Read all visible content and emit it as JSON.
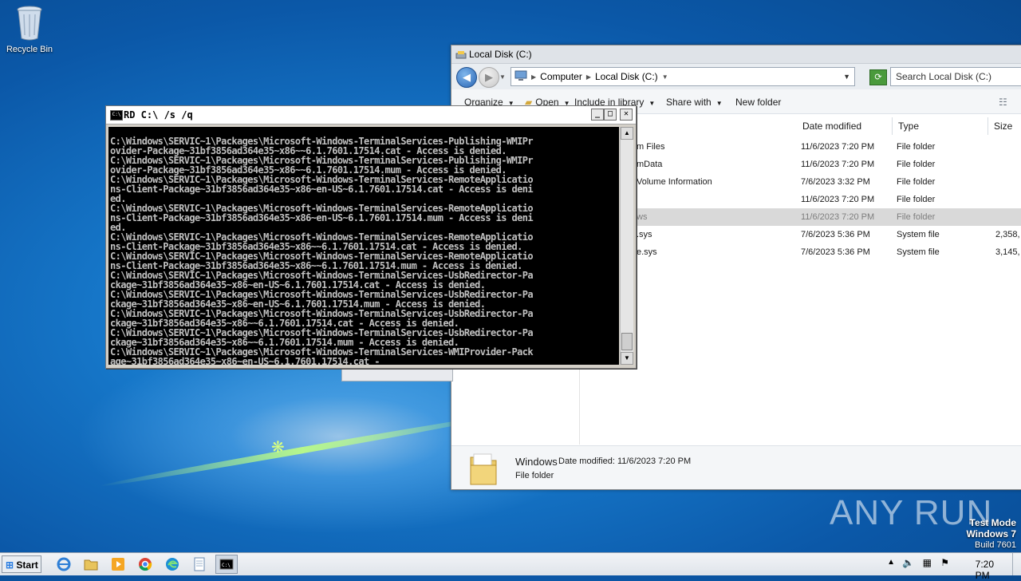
{
  "desktop": {
    "recycle_bin_label": "Recycle Bin",
    "watermark": "ANY RUN",
    "test_mode": {
      "line1": "Test Mode",
      "line2": "Windows 7",
      "line3": "Build 7601"
    }
  },
  "explorer": {
    "title": "Local Disk (C:)",
    "breadcrumb": [
      "Computer",
      "Local Disk (C:)"
    ],
    "search_placeholder": "Search Local Disk (C:)",
    "commands": {
      "organize": "Organize",
      "open": "Open",
      "include_in_library": "Include in library",
      "share_with": "Share with",
      "new_folder": "New folder"
    },
    "columns": {
      "date_modified": "Date modified",
      "type": "Type",
      "size": "Size"
    },
    "rows": [
      {
        "name": "m Files",
        "date": "11/6/2023 7:20 PM",
        "type": "File folder",
        "size": "",
        "selected": false
      },
      {
        "name": "mData",
        "date": "11/6/2023 7:20 PM",
        "type": "File folder",
        "size": "",
        "selected": false
      },
      {
        "name": "Volume Information",
        "date": "7/6/2023 3:32 PM",
        "type": "File folder",
        "size": "",
        "selected": false
      },
      {
        "name": "",
        "date": "11/6/2023 7:20 PM",
        "type": "File folder",
        "size": "",
        "selected": false
      },
      {
        "name": "ws",
        "date": "11/6/2023 7:20 PM",
        "type": "File folder",
        "size": "",
        "selected": true
      },
      {
        "name": ".sys",
        "date": "7/6/2023 5:36 PM",
        "type": "System file",
        "size": "2,358,",
        "selected": false
      },
      {
        "name": "e.sys",
        "date": "7/6/2023 5:36 PM",
        "type": "System file",
        "size": "3,145,",
        "selected": false
      }
    ],
    "details": {
      "name": "Windows",
      "modified": "Date modified: 11/6/2023 7:20 PM",
      "type": "File folder"
    }
  },
  "cmd": {
    "title": "RD C:\\ /s /q",
    "lines": [
      "",
      "C:\\Windows\\SERVIC~1\\Packages\\Microsoft-Windows-TerminalServices-Publishing-WMIPr",
      "ovider-Package~31bf3856ad364e35~x86~~6.1.7601.17514.cat - Access is denied.",
      "C:\\Windows\\SERVIC~1\\Packages\\Microsoft-Windows-TerminalServices-Publishing-WMIPr",
      "ovider-Package~31bf3856ad364e35~x86~~6.1.7601.17514.mum - Access is denied.",
      "C:\\Windows\\SERVIC~1\\Packages\\Microsoft-Windows-TerminalServices-RemoteApplicatio",
      "ns-Client-Package~31bf3856ad364e35~x86~en-US~6.1.7601.17514.cat - Access is deni",
      "ed.",
      "C:\\Windows\\SERVIC~1\\Packages\\Microsoft-Windows-TerminalServices-RemoteApplicatio",
      "ns-Client-Package~31bf3856ad364e35~x86~en-US~6.1.7601.17514.mum - Access is deni",
      "ed.",
      "C:\\Windows\\SERVIC~1\\Packages\\Microsoft-Windows-TerminalServices-RemoteApplicatio",
      "ns-Client-Package~31bf3856ad364e35~x86~~6.1.7601.17514.cat - Access is denied.",
      "C:\\Windows\\SERVIC~1\\Packages\\Microsoft-Windows-TerminalServices-RemoteApplicatio",
      "ns-Client-Package~31bf3856ad364e35~x86~~6.1.7601.17514.mum - Access is denied.",
      "C:\\Windows\\SERVIC~1\\Packages\\Microsoft-Windows-TerminalServices-UsbRedirector-Pa",
      "ckage~31bf3856ad364e35~x86~en-US~6.1.7601.17514.cat - Access is denied.",
      "C:\\Windows\\SERVIC~1\\Packages\\Microsoft-Windows-TerminalServices-UsbRedirector-Pa",
      "ckage~31bf3856ad364e35~x86~en-US~6.1.7601.17514.mum - Access is denied.",
      "C:\\Windows\\SERVIC~1\\Packages\\Microsoft-Windows-TerminalServices-UsbRedirector-Pa",
      "ckage~31bf3856ad364e35~x86~~6.1.7601.17514.cat - Access is denied.",
      "C:\\Windows\\SERVIC~1\\Packages\\Microsoft-Windows-TerminalServices-UsbRedirector-Pa",
      "ckage~31bf3856ad364e35~x86~~6.1.7601.17514.mum - Access is denied.",
      "C:\\Windows\\SERVIC~1\\Packages\\Microsoft-Windows-TerminalServices-WMIProvider-Pack",
      "age~31bf3856ad364e35~x86~en-US~6.1.7601.17514.cat -"
    ]
  },
  "taskbar": {
    "start_label": "Start",
    "clock": "7:20 PM",
    "pinned_icons": [
      "ie-icon",
      "explorer-icon",
      "media-player-icon",
      "chrome-icon",
      "edge-icon",
      "notepad-icon",
      "cmd-icon"
    ],
    "active_icon": "cmd-icon"
  },
  "colors": {
    "desktop_blue": "#1677c9",
    "console_bg": "#000000",
    "console_text": "#c0c0c0",
    "selected_row": "#d9d9d9"
  }
}
